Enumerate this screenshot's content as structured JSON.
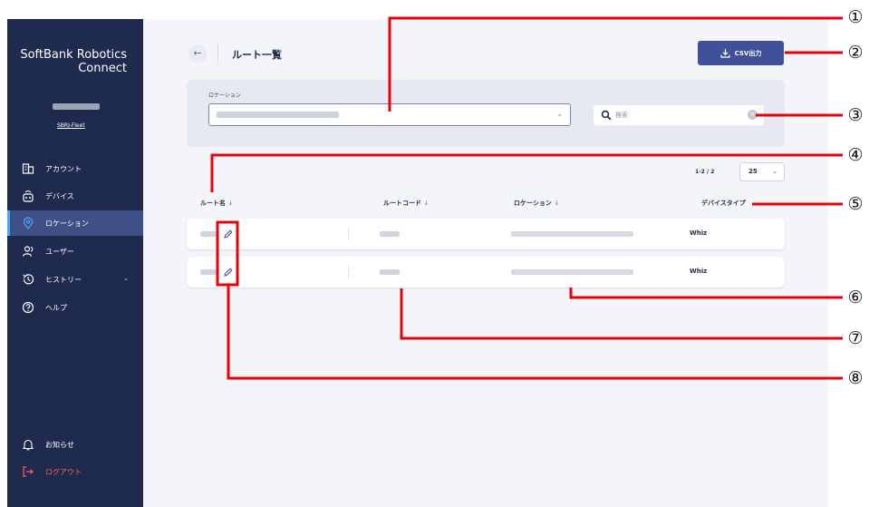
{
  "sidebar": {
    "brand_line1": "SoftBank Robotics",
    "brand_line2": "Connect",
    "collapse_glyph": "‹",
    "user_group": "SBRJ-Fleet",
    "items": [
      {
        "label": "アカウント",
        "icon": "account-building-icon"
      },
      {
        "label": "デバイス",
        "icon": "device-robot-icon"
      },
      {
        "label": "ロケーション",
        "icon": "location-pin-icon",
        "active": true
      },
      {
        "label": "ユーザー",
        "icon": "users-icon"
      },
      {
        "label": "ヒストリー",
        "icon": "history-icon",
        "chevron": "⌄"
      },
      {
        "label": "ヘルプ",
        "icon": "help-icon"
      }
    ],
    "notifications_label": "お知らせ",
    "logout_label": "ログアウト"
  },
  "header": {
    "back_glyph": "←",
    "title": "ルート一覧",
    "csv_button_label": "CSV出力"
  },
  "filter": {
    "location_label": "ロケーション",
    "location_dropdown_glyph": "⌄",
    "search_placeholder": "検索",
    "clear_glyph": "×"
  },
  "pagination": {
    "range_text": "1-2 / 2",
    "per_page_value": "25",
    "per_page_glyph": "⌄"
  },
  "table": {
    "columns": [
      {
        "label": "ルート名",
        "sort": "↓"
      },
      {
        "label": "ルートコード",
        "sort": "↓"
      },
      {
        "label": "ロケーション",
        "sort": "↓"
      },
      {
        "label": "デバイスタイプ",
        "sort": ""
      }
    ],
    "rows": [
      {
        "device_type": "Whiz"
      },
      {
        "device_type": "Whiz"
      }
    ]
  },
  "annotations": [
    "①",
    "②",
    "③",
    "④",
    "⑤",
    "⑥",
    "⑦",
    "⑧"
  ],
  "colors": {
    "sidebar_bg": "#1f2b4e",
    "active_item_bg": "#3f5086",
    "accent_button": "#3f5199",
    "logout": "#ff5b5b",
    "annotation_line": "#e8000b"
  }
}
